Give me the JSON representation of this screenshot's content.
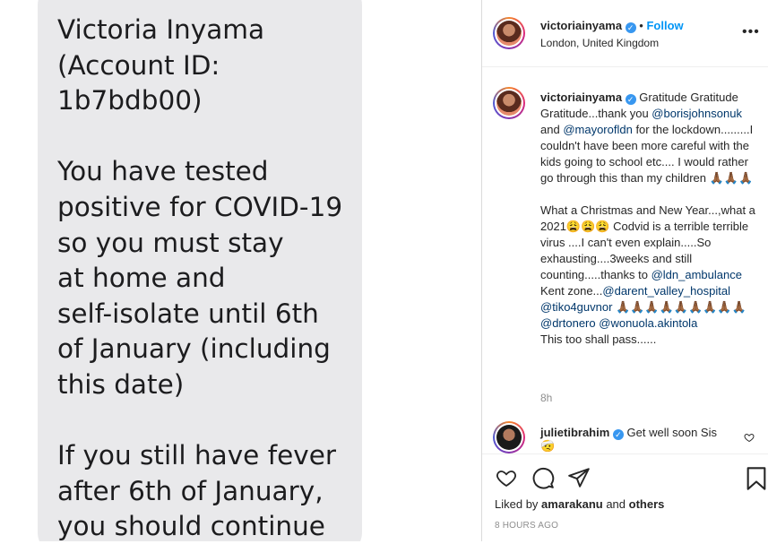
{
  "sms": {
    "text": "Victoria Inyama\n(Account ID:\n1b7bdb00)\n\nYou have tested\npositive for COVID-19\nso you must stay\nat home and\nself-isolate until 6th\nof January (including\nthis date)\n\nIf you still have fever\nafter 6th of January,\nyou should continue"
  },
  "post_header": {
    "username": "victoriainyama",
    "separator": "•",
    "follow_label": "Follow",
    "location": "London, United Kingdom",
    "more_icon": "more-horizontal-icon"
  },
  "caption": {
    "username": "victoriainyama",
    "p1_a": "Gratitude Gratitude Gratitude...thank you ",
    "mention1": "@borisjohnsonuk",
    "p1_b": " and ",
    "mention2": "@mayorofldn",
    "p1_c": " for the lockdown.........I couldn't have been more careful with the kids going to school etc.... I would rather go through this than my children 🙏🏾🙏🏾🙏🏾",
    "p2_a": "What a Christmas and New Year...,what a 2021😩😩😩 Codvid is a terrible terrible virus ....I can't even explain.....So exhausting....3weeks and still counting.....thanks to ",
    "mention3": "@ldn_ambulance",
    "p2_b": " Kent zone...",
    "mention4": "@darent_valley_hospital",
    "mention5": "@tiko4guvnor",
    "p2_c": " 🙏🏾🙏🏾🙏🏾🙏🏾🙏🏾🙏🏾🙏🏾🙏🏾🙏🏾",
    "mention6": "@drtonero",
    "mention7": "@wonuola.akintola",
    "p2_d": "This too shall pass......",
    "time": "8h"
  },
  "comment": {
    "username": "julietibrahim",
    "text": "Get well soon Sis",
    "emoji": "🤕"
  },
  "actions": {
    "liked_prefix": "Liked by ",
    "liked_user": "amarakanu",
    "liked_mid": " and ",
    "liked_others": "others",
    "timestamp": "8 HOURS AGO"
  },
  "colors": {
    "bubble": "#e9e9eb",
    "link": "#00376b",
    "follow": "#0095f6",
    "verified": "#3897f0",
    "muted": "#8e8e8e"
  }
}
